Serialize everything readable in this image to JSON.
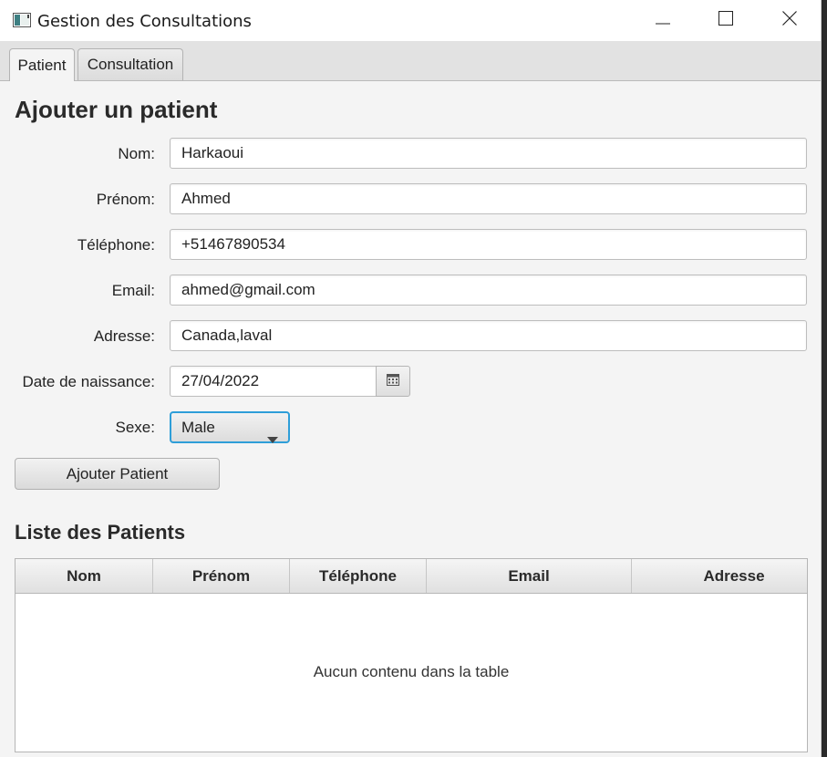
{
  "window": {
    "title": "Gestion des Consultations"
  },
  "tabs": [
    {
      "label": "Patient",
      "active": true
    },
    {
      "label": "Consultation",
      "active": false
    }
  ],
  "form": {
    "title": "Ajouter un patient",
    "fields": {
      "nom": {
        "label": "Nom:",
        "value": "Harkaoui"
      },
      "prenom": {
        "label": "Prénom:",
        "value": "Ahmed"
      },
      "telephone": {
        "label": "Téléphone:",
        "value": "+51467890534"
      },
      "email": {
        "label": "Email:",
        "value": "ahmed@gmail.com"
      },
      "adresse": {
        "label": "Adresse:",
        "value": "Canada,laval"
      },
      "date_naissance": {
        "label": "Date de naissance:",
        "value": "27/04/2022"
      },
      "sexe": {
        "label": "Sexe:",
        "value": "Male"
      }
    },
    "submit_label": "Ajouter Patient"
  },
  "list": {
    "title": "Liste des Patients",
    "columns": [
      "Nom",
      "Prénom",
      "Téléphone",
      "Email",
      "Adresse"
    ],
    "rows": [],
    "empty_message": "Aucun contenu dans la table"
  },
  "colors": {
    "accent_focus": "#2e9ed8",
    "window_bg": "#f4f4f4"
  },
  "icons": {
    "window": "app-window-icon",
    "minimize": "minimize-icon",
    "maximize": "maximize-icon",
    "close": "close-icon",
    "calendar": "calendar-icon",
    "dropdown": "chevron-down-icon"
  }
}
